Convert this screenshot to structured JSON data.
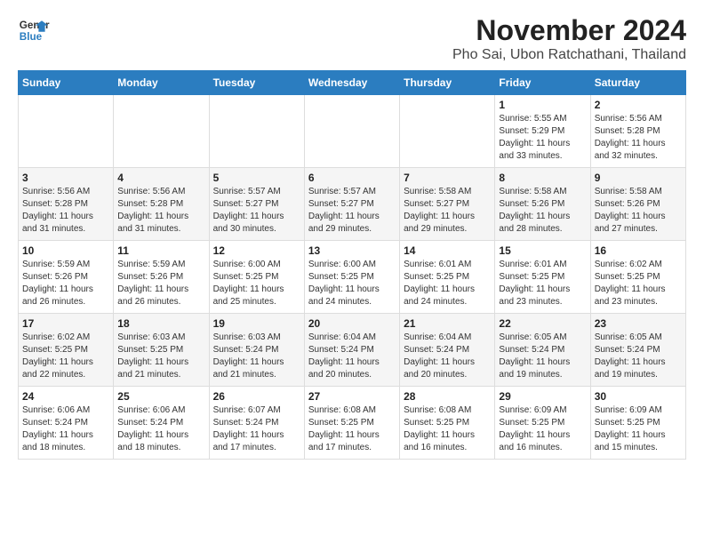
{
  "header": {
    "logo_line1": "General",
    "logo_line2": "Blue",
    "title": "November 2024",
    "subtitle": "Pho Sai, Ubon Ratchathani, Thailand"
  },
  "weekdays": [
    "Sunday",
    "Monday",
    "Tuesday",
    "Wednesday",
    "Thursday",
    "Friday",
    "Saturday"
  ],
  "weeks": [
    [
      {
        "day": "",
        "info": ""
      },
      {
        "day": "",
        "info": ""
      },
      {
        "day": "",
        "info": ""
      },
      {
        "day": "",
        "info": ""
      },
      {
        "day": "",
        "info": ""
      },
      {
        "day": "1",
        "info": "Sunrise: 5:55 AM\nSunset: 5:29 PM\nDaylight: 11 hours\nand 33 minutes."
      },
      {
        "day": "2",
        "info": "Sunrise: 5:56 AM\nSunset: 5:28 PM\nDaylight: 11 hours\nand 32 minutes."
      }
    ],
    [
      {
        "day": "3",
        "info": "Sunrise: 5:56 AM\nSunset: 5:28 PM\nDaylight: 11 hours\nand 31 minutes."
      },
      {
        "day": "4",
        "info": "Sunrise: 5:56 AM\nSunset: 5:28 PM\nDaylight: 11 hours\nand 31 minutes."
      },
      {
        "day": "5",
        "info": "Sunrise: 5:57 AM\nSunset: 5:27 PM\nDaylight: 11 hours\nand 30 minutes."
      },
      {
        "day": "6",
        "info": "Sunrise: 5:57 AM\nSunset: 5:27 PM\nDaylight: 11 hours\nand 29 minutes."
      },
      {
        "day": "7",
        "info": "Sunrise: 5:58 AM\nSunset: 5:27 PM\nDaylight: 11 hours\nand 29 minutes."
      },
      {
        "day": "8",
        "info": "Sunrise: 5:58 AM\nSunset: 5:26 PM\nDaylight: 11 hours\nand 28 minutes."
      },
      {
        "day": "9",
        "info": "Sunrise: 5:58 AM\nSunset: 5:26 PM\nDaylight: 11 hours\nand 27 minutes."
      }
    ],
    [
      {
        "day": "10",
        "info": "Sunrise: 5:59 AM\nSunset: 5:26 PM\nDaylight: 11 hours\nand 26 minutes."
      },
      {
        "day": "11",
        "info": "Sunrise: 5:59 AM\nSunset: 5:26 PM\nDaylight: 11 hours\nand 26 minutes."
      },
      {
        "day": "12",
        "info": "Sunrise: 6:00 AM\nSunset: 5:25 PM\nDaylight: 11 hours\nand 25 minutes."
      },
      {
        "day": "13",
        "info": "Sunrise: 6:00 AM\nSunset: 5:25 PM\nDaylight: 11 hours\nand 24 minutes."
      },
      {
        "day": "14",
        "info": "Sunrise: 6:01 AM\nSunset: 5:25 PM\nDaylight: 11 hours\nand 24 minutes."
      },
      {
        "day": "15",
        "info": "Sunrise: 6:01 AM\nSunset: 5:25 PM\nDaylight: 11 hours\nand 23 minutes."
      },
      {
        "day": "16",
        "info": "Sunrise: 6:02 AM\nSunset: 5:25 PM\nDaylight: 11 hours\nand 23 minutes."
      }
    ],
    [
      {
        "day": "17",
        "info": "Sunrise: 6:02 AM\nSunset: 5:25 PM\nDaylight: 11 hours\nand 22 minutes."
      },
      {
        "day": "18",
        "info": "Sunrise: 6:03 AM\nSunset: 5:25 PM\nDaylight: 11 hours\nand 21 minutes."
      },
      {
        "day": "19",
        "info": "Sunrise: 6:03 AM\nSunset: 5:24 PM\nDaylight: 11 hours\nand 21 minutes."
      },
      {
        "day": "20",
        "info": "Sunrise: 6:04 AM\nSunset: 5:24 PM\nDaylight: 11 hours\nand 20 minutes."
      },
      {
        "day": "21",
        "info": "Sunrise: 6:04 AM\nSunset: 5:24 PM\nDaylight: 11 hours\nand 20 minutes."
      },
      {
        "day": "22",
        "info": "Sunrise: 6:05 AM\nSunset: 5:24 PM\nDaylight: 11 hours\nand 19 minutes."
      },
      {
        "day": "23",
        "info": "Sunrise: 6:05 AM\nSunset: 5:24 PM\nDaylight: 11 hours\nand 19 minutes."
      }
    ],
    [
      {
        "day": "24",
        "info": "Sunrise: 6:06 AM\nSunset: 5:24 PM\nDaylight: 11 hours\nand 18 minutes."
      },
      {
        "day": "25",
        "info": "Sunrise: 6:06 AM\nSunset: 5:24 PM\nDaylight: 11 hours\nand 18 minutes."
      },
      {
        "day": "26",
        "info": "Sunrise: 6:07 AM\nSunset: 5:24 PM\nDaylight: 11 hours\nand 17 minutes."
      },
      {
        "day": "27",
        "info": "Sunrise: 6:08 AM\nSunset: 5:25 PM\nDaylight: 11 hours\nand 17 minutes."
      },
      {
        "day": "28",
        "info": "Sunrise: 6:08 AM\nSunset: 5:25 PM\nDaylight: 11 hours\nand 16 minutes."
      },
      {
        "day": "29",
        "info": "Sunrise: 6:09 AM\nSunset: 5:25 PM\nDaylight: 11 hours\nand 16 minutes."
      },
      {
        "day": "30",
        "info": "Sunrise: 6:09 AM\nSunset: 5:25 PM\nDaylight: 11 hours\nand 15 minutes."
      }
    ]
  ]
}
